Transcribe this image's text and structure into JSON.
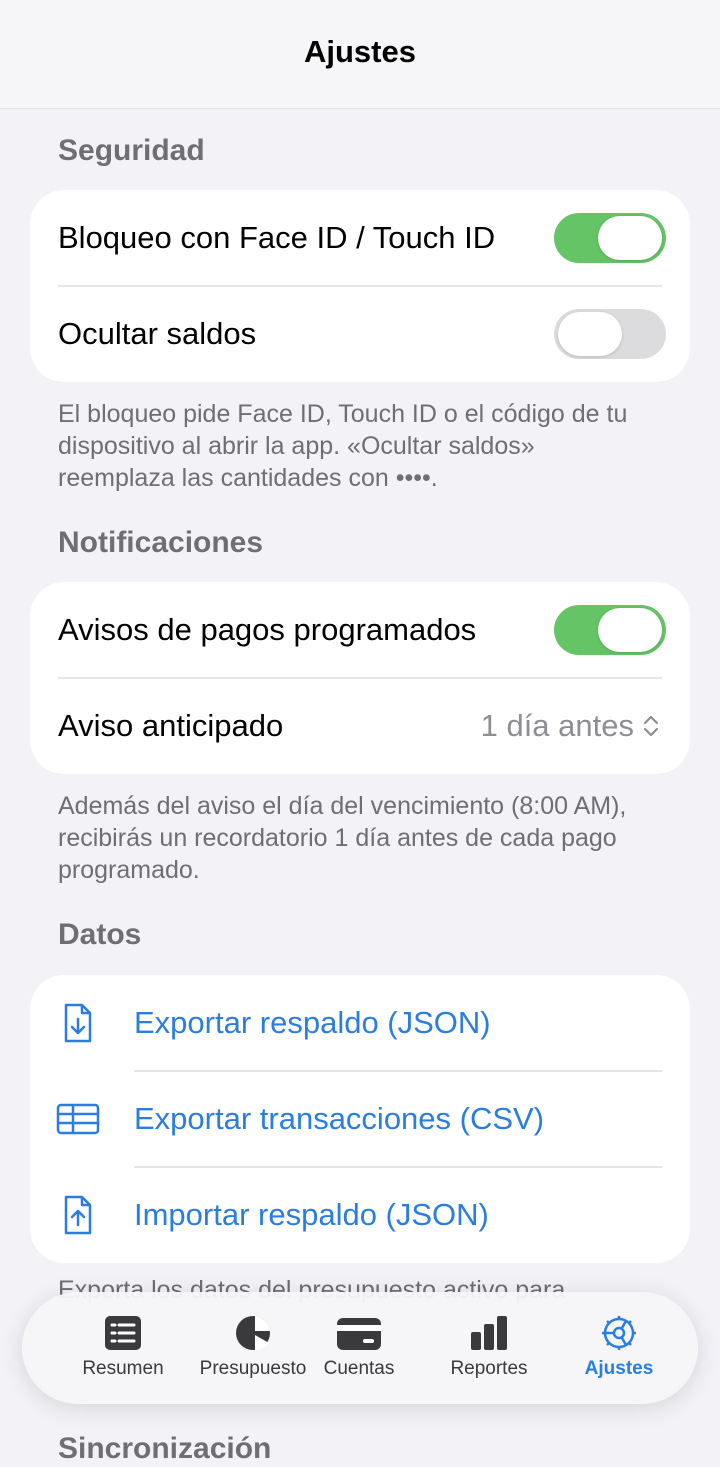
{
  "nav": {
    "title": "Ajustes"
  },
  "security": {
    "header": "Seguridad",
    "rows": [
      {
        "label": "Bloqueo con Face ID / Touch ID",
        "on": true
      },
      {
        "label": "Ocultar saldos",
        "on": false
      }
    ],
    "footer": "El bloqueo pide Face ID, Touch ID o el código de tu dispositivo al abrir la app. «Ocultar saldos» reemplaza las cantidades con ••••."
  },
  "notifications": {
    "header": "Notificaciones",
    "toggle_label": "Avisos de pagos programados",
    "toggle_on": true,
    "advance_label": "Aviso anticipado",
    "advance_value": "1 día antes",
    "footer": "Además del aviso el día del vencimiento (8:00 AM), recibirás un recordatorio 1 día antes de cada pago programado."
  },
  "data": {
    "header": "Datos",
    "actions": [
      {
        "label": "Exportar respaldo (JSON)",
        "icon": "document-download-icon"
      },
      {
        "label": "Exportar transacciones (CSV)",
        "icon": "table-icon"
      },
      {
        "label": "Importar respaldo (JSON)",
        "icon": "document-upload-icon"
      }
    ],
    "footer_peek": "Exporta los datos del presupuesto activo para"
  },
  "sync": {
    "header": "Sincronización"
  },
  "tabbar": {
    "tabs": [
      {
        "label": "Resumen",
        "icon": "list-icon",
        "active": false
      },
      {
        "label": "Presupuesto",
        "icon": "pie-chart-icon",
        "active": false
      },
      {
        "label": "Cuentas",
        "icon": "credit-card-icon",
        "active": false
      },
      {
        "label": "Reportes",
        "icon": "bar-chart-icon",
        "active": false
      },
      {
        "label": "Ajustes",
        "icon": "gear-icon",
        "active": true
      }
    ]
  },
  "colors": {
    "accent": "#2a7de1",
    "toggle_on": "#65c466",
    "background": "#f2f2f7"
  }
}
